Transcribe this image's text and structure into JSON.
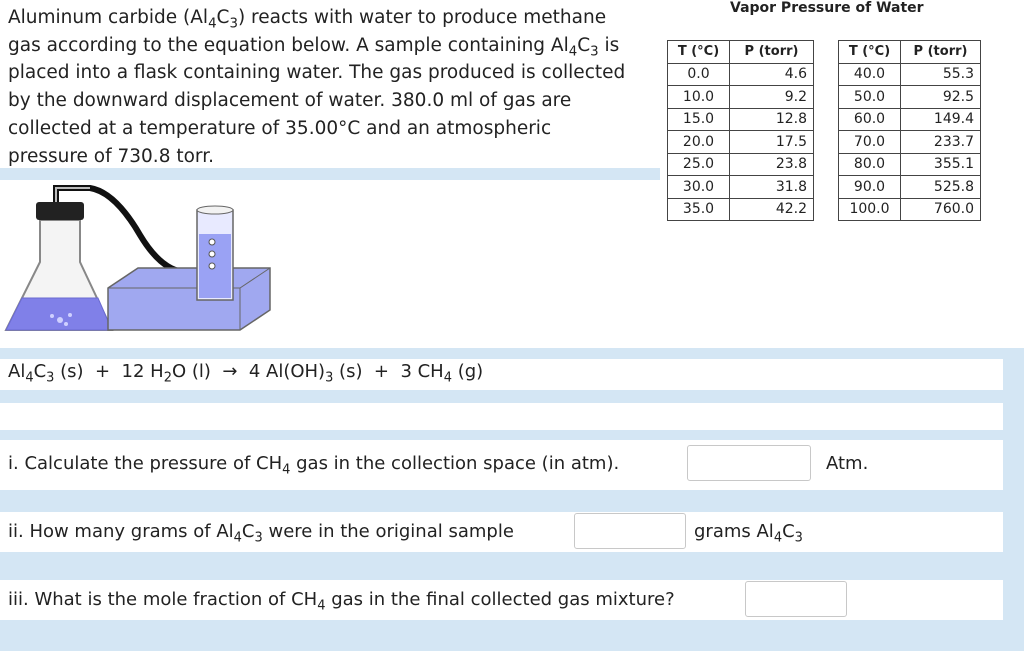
{
  "intro": {
    "line1_a": "Aluminum carbide (Al",
    "line1_sub1": "4",
    "line1_b": "C",
    "line1_sub2": "3",
    "line1_c": ") reacts with water to produce methane",
    "line2_a": "gas according to the equation below.  A sample containing Al",
    "line2_sub1": "4",
    "line2_b": "C",
    "line2_sub2": "3",
    "line2_c": " is",
    "line3": "placed into a flask containing water.  The gas produced is collected",
    "line4": "by the downward displacement of water.  380.0 ml of gas are",
    "line5": "collected at a temperature of 35.00°C and an atmospheric",
    "line6": "pressure of 730.8 torr."
  },
  "vapor_table": {
    "title": "Vapor Pressure of Water",
    "header_t": "T (°C)",
    "header_p": "P (torr)",
    "left": [
      {
        "t": "0.0",
        "p": "4.6"
      },
      {
        "t": "10.0",
        "p": "9.2"
      },
      {
        "t": "15.0",
        "p": "12.8"
      },
      {
        "t": "20.0",
        "p": "17.5"
      },
      {
        "t": "25.0",
        "p": "23.8"
      },
      {
        "t": "30.0",
        "p": "31.8"
      },
      {
        "t": "35.0",
        "p": "42.2"
      }
    ],
    "right": [
      {
        "t": "40.0",
        "p": "55.3"
      },
      {
        "t": "50.0",
        "p": "92.5"
      },
      {
        "t": "60.0",
        "p": "149.4"
      },
      {
        "t": "70.0",
        "p": "233.7"
      },
      {
        "t": "80.0",
        "p": "355.1"
      },
      {
        "t": "90.0",
        "p": "525.8"
      },
      {
        "t": "100.0",
        "p": "760.0"
      }
    ]
  },
  "equation": {
    "p1": "Al",
    "s1": "4",
    "p2": "C",
    "s2": "3",
    "p3": " (s)  +  12 H",
    "s3": "2",
    "p4": "O (l)  →  4 Al(OH)",
    "s4": "3",
    "p5": " (s)  +  3 CH",
    "s5": "4",
    "p6": " (g)"
  },
  "questions": [
    {
      "a": "i. Calculate the pressure of CH",
      "sub": "4",
      "b": " gas in the collection space (in atm).",
      "value": "",
      "unit_a": "Atm.",
      "unit_sub": "",
      "unit_b": ""
    },
    {
      "a": "ii. How many grams of Al",
      "sub": "4",
      "b": "C",
      "sub2": "3",
      "c": " were in the original sample",
      "value": "",
      "unit_a": "grams Al",
      "unit_sub": "4",
      "unit_b": "C",
      "unit_sub2": "3"
    },
    {
      "a": "iii. What is the mole fraction of CH",
      "sub": "4",
      "b": " gas in the final collected gas mixture?",
      "value": ""
    }
  ],
  "colors": {
    "background": "#d4e6f4",
    "liquid": "#8080e8",
    "tray": "#a0a8f0"
  }
}
